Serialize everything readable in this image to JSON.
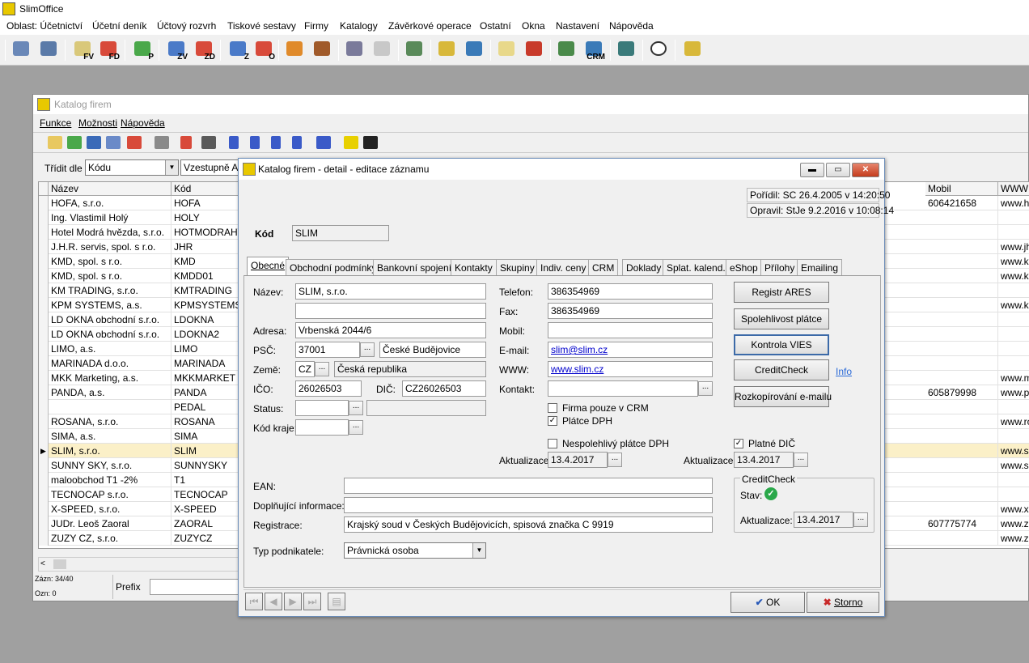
{
  "app": {
    "title": "SlimOffice"
  },
  "menu": [
    "Oblast: Účetnictví",
    "Účetní deník",
    "Účtový rozvrh",
    "Tiskové sestavy",
    "Firmy",
    "Katalogy",
    "Závěrkové operace",
    "Ostatní",
    "Okna",
    "Nastavení",
    "Nápověda"
  ],
  "toolbar": {
    "icons": [
      "columns-icon",
      "adjust-icon",
      "invoice-issued-icon",
      "invoice-received-icon",
      "payment-icon",
      "advance-issued-icon",
      "advance-received-icon",
      "order-z-icon",
      "order-o-icon",
      "box-icon",
      "books-icon",
      "bank-icon",
      "sign-icon",
      "printer-icon",
      "bag-icon",
      "truck-icon",
      "document-icon",
      "stamp-icon",
      "people-icon",
      "crm-icon",
      "house-people-icon",
      "info-icon",
      "export-icon"
    ],
    "labels": {
      "fv": "FV",
      "fd": "FD",
      "p": "P",
      "zv": "ZV",
      "zd": "ZD",
      "z": "Z",
      "o": "O",
      "crm": "CRM"
    }
  },
  "catalog": {
    "title": "Katalog firem",
    "menu": [
      "Funkce",
      "Možnosti",
      "Nápověda"
    ],
    "sort_label": "Třídit dle",
    "sort_value": "Kódu",
    "order_value": "Vzestupně  A",
    "columns": [
      "Název",
      "Kód",
      "Mobil",
      "WWW"
    ],
    "rows": [
      {
        "name": "HOFA, s.r.o.",
        "code": "HOFA",
        "mobile": "606421658",
        "www": "www.ho"
      },
      {
        "name": "Ing. Vlastimil Holý",
        "code": "HOLY",
        "mobile": "",
        "www": ""
      },
      {
        "name": "Hotel Modrá hvězda, s.r.o.",
        "code": "HOTMODRAHV",
        "mobile": "",
        "www": ""
      },
      {
        "name": "J.H.R. servis, spol. s r.o.",
        "code": "JHR",
        "mobile": "",
        "www": "www.jhr"
      },
      {
        "name": "KMD, spol. s r.o.",
        "code": "KMD",
        "mobile": "",
        "www": "www.km"
      },
      {
        "name": "KMD, spol. s r.o.",
        "code": "KMDD01",
        "mobile": "",
        "www": "www.km"
      },
      {
        "name": "KM TRADING, s.r.o.",
        "code": "KMTRADING",
        "mobile": "",
        "www": ""
      },
      {
        "name": "KPM SYSTEMS, a.s.",
        "code": "KPMSYSTEMS",
        "mobile": "",
        "www": "www.kp"
      },
      {
        "name": "LD OKNA obchodní s.r.o.",
        "code": "LDOKNA",
        "mobile": "",
        "www": ""
      },
      {
        "name": "LD OKNA obchodní s.r.o.",
        "code": "LDOKNA2",
        "mobile": "",
        "www": ""
      },
      {
        "name": "LIMO, a.s.",
        "code": "LIMO",
        "mobile": "",
        "www": ""
      },
      {
        "name": "MARINADA d.o.o.",
        "code": "MARINADA",
        "mobile": "",
        "www": ""
      },
      {
        "name": "MKK Marketing, a.s.",
        "code": "MKKMARKET",
        "mobile": "",
        "www": "www.mk"
      },
      {
        "name": "PANDA, a.s.",
        "code": "PANDA",
        "mobile": "605879998",
        "www": "www.pa"
      },
      {
        "name": "",
        "code": "PEDAL",
        "mobile": "",
        "www": ""
      },
      {
        "name": "ROSANA, s.r.o.",
        "code": "ROSANA",
        "mobile": "",
        "www": "www.ros"
      },
      {
        "name": "SIMA, a.s.",
        "code": "SIMA",
        "mobile": "",
        "www": ""
      },
      {
        "name": "SLIM, s.r.o.",
        "code": "SLIM",
        "mobile": "",
        "www": "www.slir"
      },
      {
        "name": "SUNNY SKY, s.r.o.",
        "code": "SUNNYSKY",
        "mobile": "",
        "www": "www.su"
      },
      {
        "name": "maloobchod T1 -2%",
        "code": "T1",
        "mobile": "",
        "www": ""
      },
      {
        "name": "TECNOCAP s.r.o.",
        "code": "TECNOCAP",
        "mobile": "",
        "www": ""
      },
      {
        "name": "X-SPEED, s.r.o.",
        "code": "X-SPEED",
        "mobile": "",
        "www": "www.x-s"
      },
      {
        "name": "JUDr. Leoš Zaoral",
        "code": "ZAORAL",
        "mobile": "607775774",
        "www": "www.za"
      },
      {
        "name": "ZUZY CZ, s.r.o.",
        "code": "ZUZYCZ",
        "mobile": "",
        "www": "www.zu"
      }
    ],
    "status_records": "Zázn: 34/40",
    "status_marked": "Ozn: 0",
    "prefix_label": "Prefix"
  },
  "detail": {
    "title": "Katalog firem - detail - editace záznamu",
    "created": "Pořídil: SC 26.4.2005 v 14:20:50",
    "modified": "Opravil: StJe 9.2.2016 v 10:08:14",
    "code_label": "Kód",
    "code_value": "SLIM",
    "tabs": [
      "Obecné",
      "Obchodní podmínky",
      "Bankovní spojení",
      "Kontakty",
      "Skupiny",
      "Indiv. ceny",
      "CRM",
      "Doklady",
      "Splat. kalend.",
      "eShop",
      "Přílohy",
      "Emailing"
    ],
    "labels": {
      "name": "Název:",
      "address": "Adresa:",
      "zip": "PSČ:",
      "country": "Země:",
      "ico": "IČO:",
      "dic": "DIČ:",
      "status": "Status:",
      "region": "Kód kraje:",
      "phone": "Telefon:",
      "fax": "Fax:",
      "mobile": "Mobil:",
      "email": "E-mail:",
      "www": "WWW:",
      "contact": "Kontakt:",
      "ean": "EAN:",
      "additional": "Doplňující informace:",
      "registration": "Registrace:",
      "business_type": "Typ podnikatele:",
      "updated": "Aktualizace:",
      "updated2": "Aktualizace:"
    },
    "values": {
      "name": "SLIM, s.r.o.",
      "name2": "",
      "address": "Vrbenská 2044/6",
      "zip": "37001",
      "city": "České Budějovice",
      "country_code": "CZ",
      "country_name": "Česká republika",
      "ico": "26026503",
      "dic": "CZ26026503",
      "phone": "386354969",
      "fax": "386354969",
      "mobile": "",
      "email": "slim@slim.cz",
      "www": "www.slim.cz",
      "contact": "",
      "ean": "",
      "additional": "",
      "registration": "Krajský soud v Českých Budějovicích, spisová značka C 9919",
      "business_type": "Právnická osoba",
      "vat_update": "13.4.2017",
      "dic_update": "13.4.2017"
    },
    "checks": {
      "crm_only": {
        "label": "Firma pouze v CRM",
        "checked": false
      },
      "vat_payer": {
        "label": "Plátce DPH",
        "checked": true
      },
      "unreliable": {
        "label": "Nespolehlivý plátce DPH",
        "checked": false
      },
      "valid_dic": {
        "label": "Platné DIČ",
        "checked": true
      }
    },
    "buttons": {
      "ares": "Registr ARES",
      "reliability": "Spolehlivost plátce",
      "vies": "Kontrola VIES",
      "creditcheck": "CreditCheck",
      "info_link": "Info",
      "email_split": "Rozkopírování e-mailu",
      "ok": "OK",
      "cancel": "Storno"
    },
    "creditcheck_box": {
      "title": "CreditCheck",
      "state_label": "Stav:",
      "update_label": "Aktualizace:",
      "update_value": "13.4.2017"
    }
  }
}
